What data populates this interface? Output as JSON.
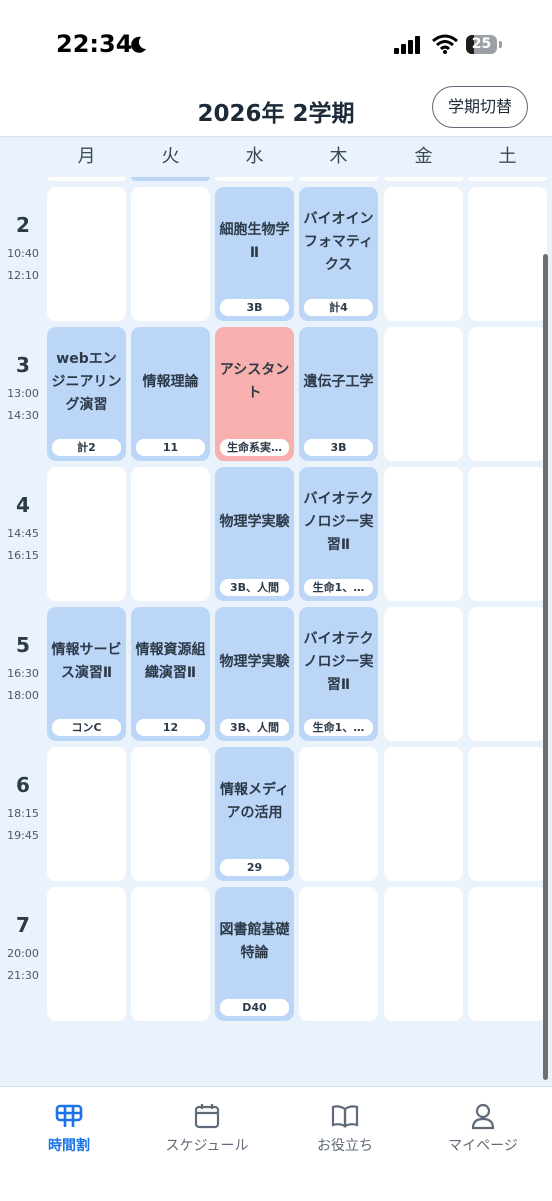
{
  "status_bar": {
    "time": "22:34",
    "battery": "25",
    "battery_level": 0.25
  },
  "header": {
    "title": "2026年 2学期",
    "term_switch_label": "学期切替"
  },
  "days": [
    "月",
    "火",
    "水",
    "木",
    "金",
    "土"
  ],
  "periods": [
    {
      "num": "2",
      "start": "10:40",
      "end": "12:10"
    },
    {
      "num": "3",
      "start": "13:00",
      "end": "14:30"
    },
    {
      "num": "4",
      "start": "14:45",
      "end": "16:15"
    },
    {
      "num": "5",
      "start": "16:30",
      "end": "18:00"
    },
    {
      "num": "6",
      "start": "18:15",
      "end": "19:45"
    },
    {
      "num": "7",
      "start": "20:00",
      "end": "21:30"
    }
  ],
  "timetable": [
    [
      null,
      null,
      {
        "name": "細胞生物学Ⅱ",
        "room": "3B"
      },
      {
        "name": "バイオインフォマティクス",
        "room": "計4"
      },
      null,
      null
    ],
    [
      {
        "name": "webエンジニアリング演習",
        "room": "計2"
      },
      {
        "name": "情報理論",
        "room": "11"
      },
      {
        "name": "アシスタント",
        "room": "生命系実…",
        "highlight": true
      },
      {
        "name": "遺伝子工学",
        "room": "3B"
      },
      null,
      null
    ],
    [
      null,
      null,
      {
        "name": "物理学実験",
        "room": "3B、人間"
      },
      {
        "name": "バイオテクノロジー実習Ⅱ",
        "room": "生命1、…"
      },
      null,
      null
    ],
    [
      {
        "name": "情報サービス演習Ⅱ",
        "room": "コンC"
      },
      {
        "name": "情報資源組織演習Ⅱ",
        "room": "12"
      },
      {
        "name": "物理学実験",
        "room": "3B、人間"
      },
      {
        "name": "バイオテクノロジー実習Ⅱ",
        "room": "生命1、…"
      },
      null,
      null
    ],
    [
      null,
      null,
      {
        "name": "情報メディアの活用",
        "room": "29"
      },
      null,
      null,
      null
    ],
    [
      null,
      null,
      {
        "name": "図書館基礎特論",
        "room": "D40"
      },
      null,
      null,
      null
    ]
  ],
  "bottom_nav": {
    "items": [
      {
        "label": "時間割",
        "icon": "timetable-icon",
        "active": true
      },
      {
        "label": "スケジュール",
        "icon": "calendar-icon",
        "active": false
      },
      {
        "label": "お役立ち",
        "icon": "book-icon",
        "active": false
      },
      {
        "label": "マイページ",
        "icon": "person-icon",
        "active": false
      }
    ]
  },
  "colors": {
    "accent": "#1a73e8",
    "course_bg": "#bcd6f7",
    "highlight_bg": "#f7b0ae",
    "grid_bg": "#eaf2fc"
  }
}
